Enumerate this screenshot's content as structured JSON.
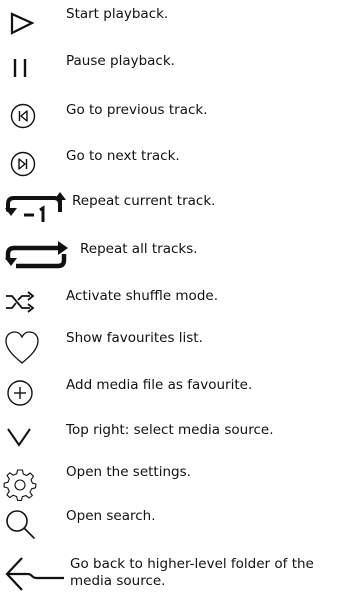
{
  "legend": {
    "items": [
      {
        "icon": "play-icon",
        "text": "Start playback."
      },
      {
        "icon": "pause-icon",
        "text": "Pause playback."
      },
      {
        "icon": "previous-track-icon",
        "text": "Go to previous track."
      },
      {
        "icon": "next-track-icon",
        "text": "Go to next track."
      },
      {
        "icon": "repeat-one-icon",
        "text": "Repeat current track."
      },
      {
        "icon": "repeat-all-icon",
        "text": "Repeat all tracks."
      },
      {
        "icon": "shuffle-icon",
        "text": "Activate shuffle mode."
      },
      {
        "icon": "heart-icon",
        "text": "Show favourites list."
      },
      {
        "icon": "add-favourite-icon",
        "text": "Add media file as favourite."
      },
      {
        "icon": "chevron-down-icon",
        "text": "Top right: select media source."
      },
      {
        "icon": "gear-icon",
        "text": "Open the settings."
      },
      {
        "icon": "search-icon",
        "text": "Open search."
      },
      {
        "icon": "back-arrow-icon",
        "text": "Go back to higher-level folder of the media source."
      }
    ]
  },
  "colors": {
    "ink": "#111111",
    "background": "#ffffff"
  }
}
